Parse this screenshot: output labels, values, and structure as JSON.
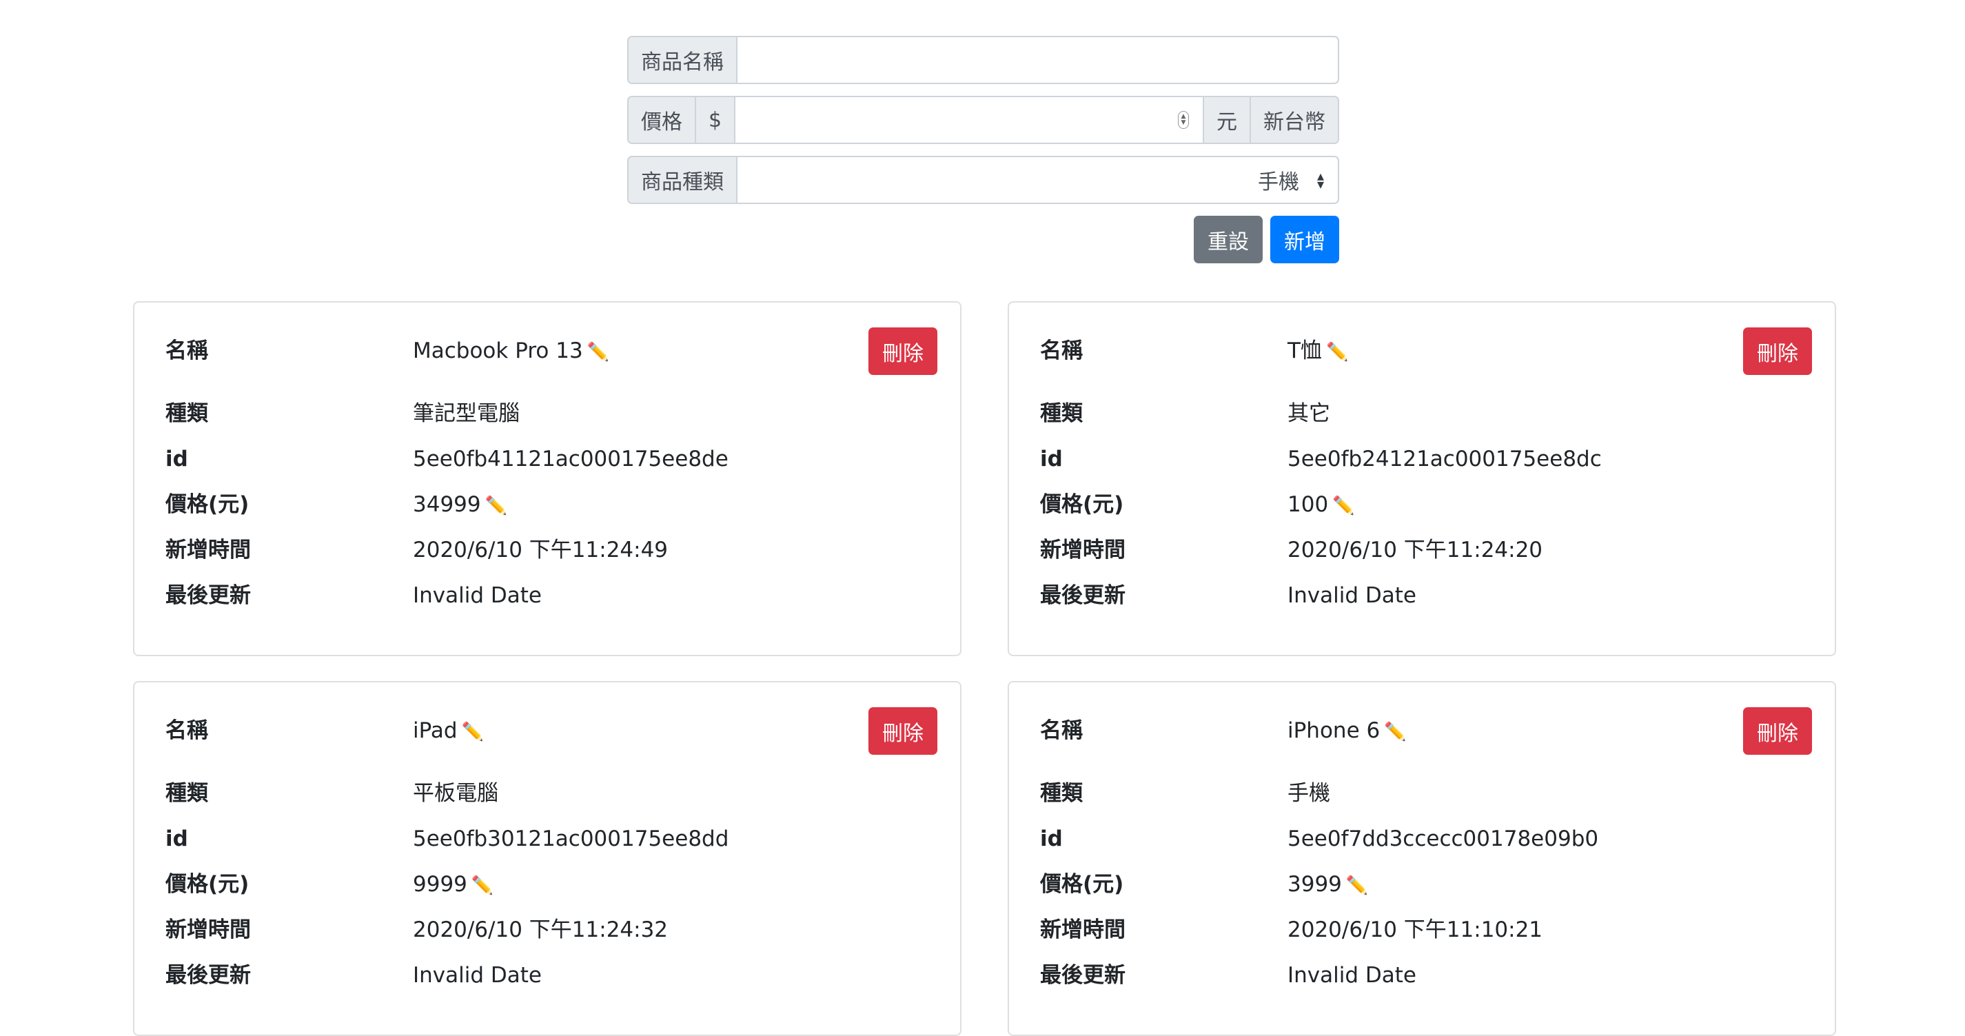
{
  "form": {
    "name_label": "商品名稱",
    "name_value": "",
    "price_label": "價格",
    "currency_symbol": "$",
    "price_value": "",
    "unit": "元",
    "currency_name": "新台幣",
    "category_label": "商品種類",
    "category_selected": "手機",
    "reset_label": "重設",
    "add_label": "新增"
  },
  "labels": {
    "name": "名稱",
    "category": "種類",
    "id": "id",
    "price": "價格(元)",
    "created": "新增時間",
    "updated": "最後更新",
    "delete": "刪除"
  },
  "products": [
    {
      "name": "Macbook Pro 13",
      "category": "筆記型電腦",
      "id": "5ee0fb41121ac000175ee8de",
      "price": "34999",
      "created": "2020/6/10 下午11:24:49",
      "updated": "Invalid Date"
    },
    {
      "name": "T恤",
      "category": "其它",
      "id": "5ee0fb24121ac000175ee8dc",
      "price": "100",
      "created": "2020/6/10 下午11:24:20",
      "updated": "Invalid Date"
    },
    {
      "name": "iPad",
      "category": "平板電腦",
      "id": "5ee0fb30121ac000175ee8dd",
      "price": "9999",
      "created": "2020/6/10 下午11:24:32",
      "updated": "Invalid Date"
    },
    {
      "name": "iPhone 6",
      "category": "手機",
      "id": "5ee0f7dd3ccecc00178e09b0",
      "price": "3999",
      "created": "2020/6/10 下午11:10:21",
      "updated": "Invalid Date"
    }
  ],
  "icons": {
    "edit": "pencil-icon",
    "pencil_glyph": "✏️"
  }
}
